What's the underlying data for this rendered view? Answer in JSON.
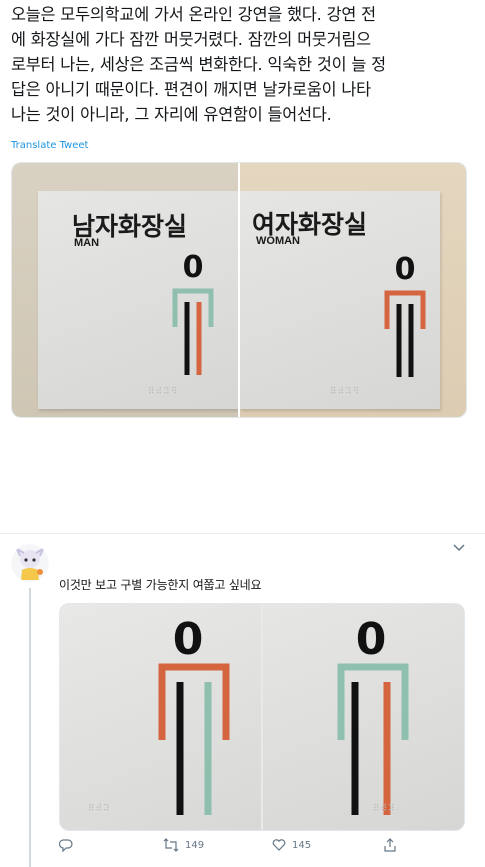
{
  "tweet": {
    "text": "오늘은 모두의학교에 가서 온라인 강연을 했다. 강연 전\n에 화장실에 가다 잠깐 머뭇거렸다. 잠깐의 머뭇거림으\n로부터 나는, 세상은 조금씩 변화한다. 익숙한 것이 늘 정\n답은 아니기 때문이다. 편견이 깨지면 날카로움이 나타\n나는 것이 아니라, 그 자리에 유연함이 들어선다.",
    "translate_label": "Translate Tweet"
  },
  "photos_top": {
    "left": {
      "title": "남자화장실",
      "subtitle": "MAN",
      "head_glyph": "0",
      "shoulder_color": "#8fbfae",
      "left_leg_color": "#111111",
      "right_leg_color": "#d4653f"
    },
    "right": {
      "title": "여자화장실",
      "subtitle": "WOMAN",
      "head_glyph": "0",
      "shoulder_color": "#d4653f",
      "left_leg_color": "#111111",
      "right_leg_color": "#111111"
    }
  },
  "reply": {
    "text": "이것만 보고 구별 가능한지 여쭙고 싶네요",
    "photos": {
      "left": {
        "head_glyph": "0",
        "shoulder_color": "#d4653f",
        "left_leg_color": "#111111",
        "right_leg_color": "#8fbfae"
      },
      "right": {
        "head_glyph": "0",
        "shoulder_color": "#8fbfae",
        "left_leg_color": "#111111",
        "right_leg_color": "#d4653f"
      }
    },
    "actions": {
      "reply_count": "",
      "retweet_count": "149",
      "like_count": "145"
    }
  },
  "colors": {
    "accent": "#1b95e0",
    "muted": "#657786"
  }
}
